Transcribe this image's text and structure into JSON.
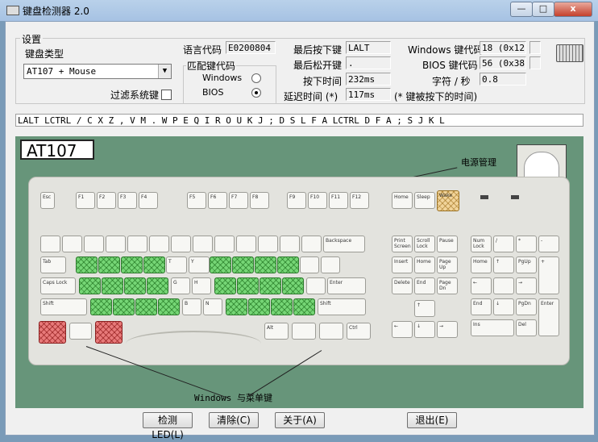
{
  "window": {
    "title": "键盘检测器 2.0",
    "minimize": "—",
    "maximize": "□",
    "close": "x"
  },
  "settings": {
    "group_label": "设置",
    "keyboard_type_label": "键盘类型",
    "keyboard_type_value": "AT107 + Mouse",
    "filter_label": "过滤系统键",
    "language_code_label": "语言代码",
    "language_code_value": "E0200804",
    "match_group_label": "匹配键代码",
    "windows_label": "Windows",
    "bios_label": "BIOS",
    "selected": "BIOS"
  },
  "info": {
    "last_pressed_label": "最后按下键",
    "last_pressed_value": "LALT",
    "last_released_label": "最后松开键",
    "last_released_value": ".",
    "press_time_label": "按下时间",
    "press_time_value": "232ms",
    "delay_label": "延迟时间 (*)",
    "delay_value": "117ms",
    "win_code_label": "Windows 键代码",
    "win_code_value": "18 (0x12)",
    "bios_code_label": "BIOS 键代码",
    "bios_code_value": "56 (0x38)",
    "cps_label": "字符 / 秒",
    "cps_value": "0.8",
    "note": "(* 键被按下的时间)"
  },
  "key_sequence": "LALT LCTRL / C X Z , V M . W P E Q I R O U K J ; D S L F A LCTRL D F A ; S J K L",
  "keyboard": {
    "model": "AT107",
    "power_label": "电源管理",
    "win_menu_label": "Windows 与菜单键",
    "keys": {
      "esc": "Esc",
      "f1": "F1",
      "f2": "F2",
      "f3": "F3",
      "f4": "F4",
      "f5": "F5",
      "f6": "F6",
      "f7": "F7",
      "f8": "F8",
      "f9": "F9",
      "f10": "F10",
      "f11": "F11",
      "f12": "F12",
      "home": "Home",
      "sleep": "Sleep",
      "wake": "Wake",
      "num_lock": "Num Lock",
      "caps_lock": "Caps Lock",
      "scroll_lock": "Scroll Lock",
      "backspace": "Backspace",
      "tab": "Tab",
      "enter": "Enter",
      "shift": "Shift",
      "print_screen": "Print Screen",
      "scroll": "Scroll Lock",
      "pause": "Pause",
      "insert": "Insert",
      "home2": "Home",
      "page_up": "Page Up",
      "delete": "Delete",
      "end": "End",
      "page_down": "Page Dn",
      "alt": "Alt",
      "ctrl": "Ctrl",
      "t": "T",
      "y": "Y",
      "g": "G",
      "h": "H",
      "b": "B",
      "n": "N",
      "np_home": "Home",
      "np_end": "End",
      "np_pgup": "PgUp",
      "np_pgdn": "PgDn",
      "np_ins": "Ins",
      "np_del": "Del"
    }
  },
  "buttons": {
    "detect_led": "检测LED(L)",
    "clear": "清除(C)",
    "about": "关于(A)",
    "exit": "退出(E)"
  }
}
